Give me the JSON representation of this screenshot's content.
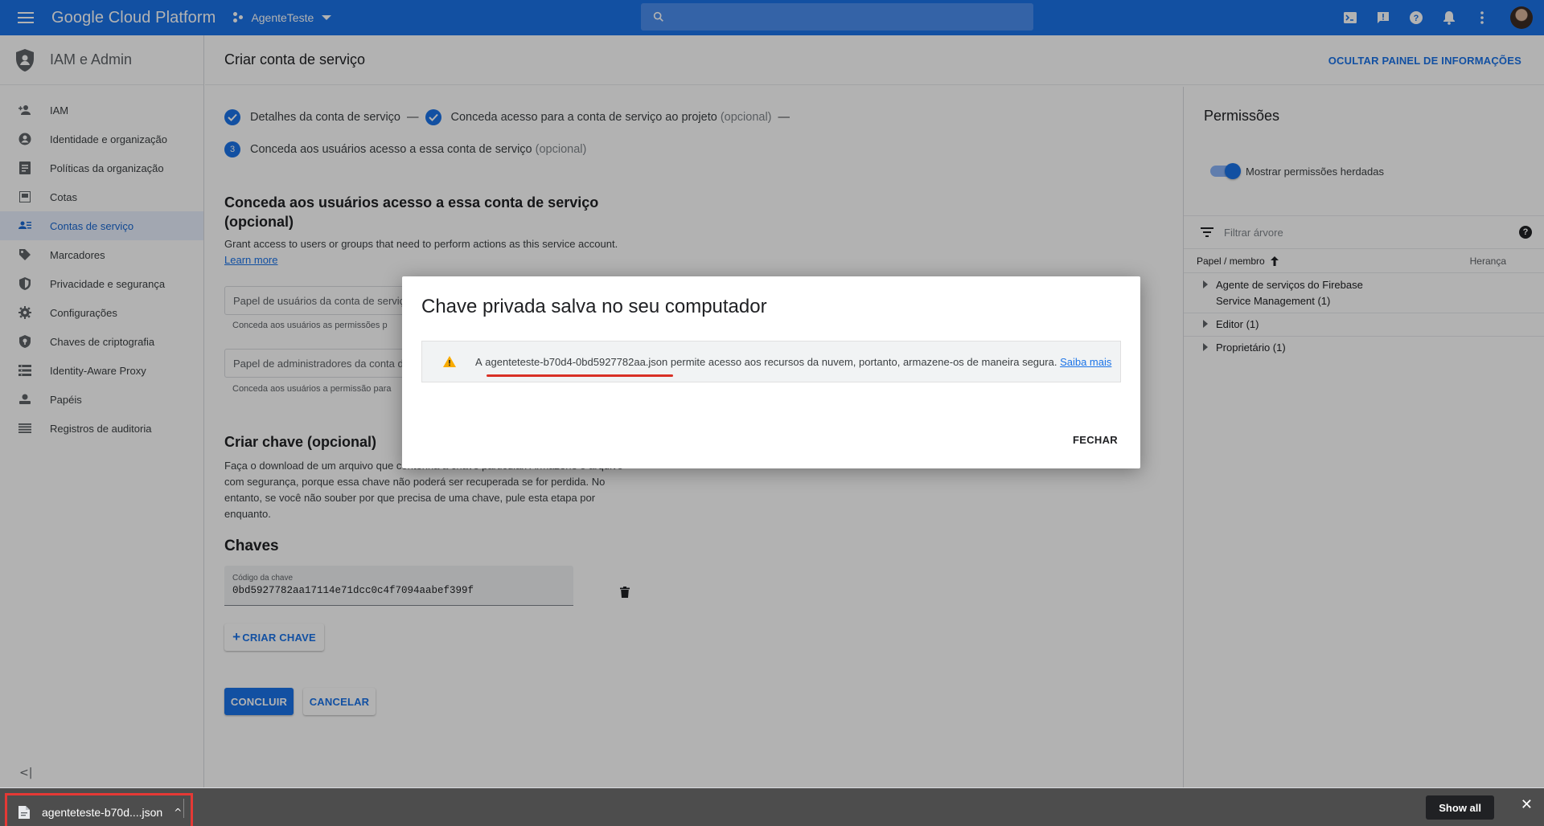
{
  "topbar": {
    "brand": "Google Cloud Platform",
    "project": "AgenteTeste",
    "search_placeholder": ""
  },
  "sidebar": {
    "title": "IAM e Admin",
    "items": [
      {
        "label": "IAM",
        "icon": "person-add-icon"
      },
      {
        "label": "Identidade e organização",
        "icon": "account-circle-icon"
      },
      {
        "label": "Políticas da organização",
        "icon": "policy-doc-icon"
      },
      {
        "label": "Cotas",
        "icon": "quota-icon"
      },
      {
        "label": "Contas de serviço",
        "icon": "service-account-icon",
        "active": true
      },
      {
        "label": "Marcadores",
        "icon": "tag-icon"
      },
      {
        "label": "Privacidade e segurança",
        "icon": "security-shield-icon"
      },
      {
        "label": "Configurações",
        "icon": "gear-icon"
      },
      {
        "label": "Chaves de criptografia",
        "icon": "key-shield-icon"
      },
      {
        "label": "Identity-Aware Proxy",
        "icon": "proxy-icon"
      },
      {
        "label": "Papéis",
        "icon": "roles-icon"
      },
      {
        "label": "Registros de auditoria",
        "icon": "audit-list-icon"
      }
    ],
    "collapse_label": "<|"
  },
  "main": {
    "page_title": "Criar conta de serviço",
    "hide_panel": "OCULTAR PAINEL DE INFORMAÇÕES",
    "steps": {
      "step1": "Detalhes da conta de serviço",
      "step2": "Conceda acesso para a conta de serviço ao projeto",
      "step2_opt": "(opcional)",
      "step3_num": "3",
      "step3": "Conceda aos usuários acesso a essa conta de serviço",
      "step3_opt": "(opcional)",
      "dash": "—"
    },
    "grant_section": {
      "title_line1": "Conceda aos usuários acesso a essa conta de serviço",
      "title_line2": "(opcional)",
      "desc": "Grant access to users or groups that need to perform actions as this service account.",
      "learn_more": "Learn more",
      "field1_placeholder": "Papel de usuários da conta de serviç",
      "field1_hint": "Conceda aos usuários as permissões p",
      "field2_placeholder": "Papel de administradores da conta d",
      "field2_hint": "Conceda aos usuários a permissão para"
    },
    "key_section": {
      "title": "Criar chave (opcional)",
      "desc_line1": "Faça o download de um arquivo que contenha a chave particular. Armazene o arquivo",
      "desc_line2": "com segurança, porque essa chave não poderá ser recuperada se for perdida. No",
      "desc_line3": "entanto, se você não souber por que precisa de uma chave, pule esta etapa por",
      "desc_line4": "enquanto."
    },
    "keys": {
      "title": "Chaves",
      "field_label": "Código da chave",
      "field_value": "0bd5927782aa17114e71dcc0c4f7094aabef399f",
      "create_button": "CRIAR CHAVE"
    },
    "done_button": "CONCLUIR",
    "cancel_button": "CANCELAR"
  },
  "right_panel": {
    "title": "Permissões",
    "toggle_label": "Mostrar permissões herdadas",
    "filter_placeholder": "Filtrar árvore",
    "col_role": "Papel / membro",
    "col_inherit": "Herança",
    "rows": [
      {
        "line1": "Agente de serviços do Firebase",
        "line2": "Service Management (1)"
      },
      {
        "line1": "Editor (1)"
      },
      {
        "line1": "Proprietário (1)"
      }
    ]
  },
  "modal": {
    "title": "Chave privada salva no seu computador",
    "alert_prefix": "A",
    "alert_filename": "agenteteste-b70d4-0bd5927782aa.json",
    "alert_suffix": "permite acesso aos recursos da nuvem, portanto, armazene-os de maneira segura.",
    "alert_link": "Saiba mais",
    "close_button": "FECHAR",
    "colors": {
      "warning": "#f9ab00",
      "highlight_underline": "#d93025"
    }
  },
  "download_bar": {
    "file_name": "agenteteste-b70d....json",
    "caret": "^",
    "show_all": "Show all",
    "close": "✕",
    "highlight_color": "#e53935"
  }
}
